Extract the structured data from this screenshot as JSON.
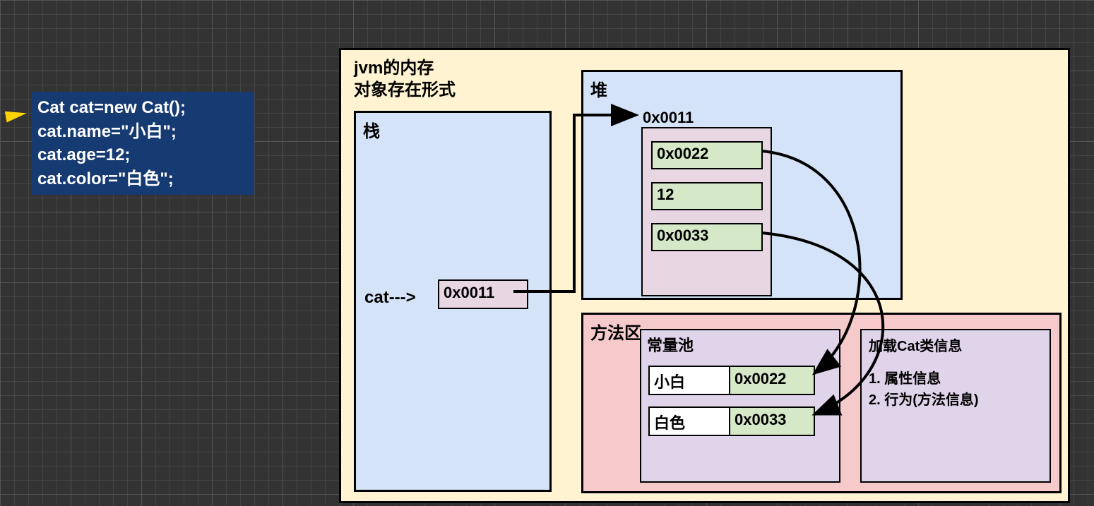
{
  "code": {
    "line1": "Cat cat=new Cat();",
    "line2": "cat.name=\"小白\";",
    "line3": "cat.age=12;",
    "line4": "cat.color=\"白色\";"
  },
  "jvm": {
    "title_line1": "jvm的内存",
    "title_line2": "对象存在形式"
  },
  "stack": {
    "label": "栈",
    "var": "cat--->",
    "addr": "0x0011"
  },
  "heap": {
    "label": "堆",
    "object_addr": "0x0011",
    "fields": {
      "name_ref": "0x0022",
      "age": "12",
      "color_ref": "0x0033"
    }
  },
  "method_area": {
    "label": "方法区",
    "const_pool": {
      "label": "常量池",
      "entry1": {
        "value": "小白",
        "addr": "0x0022"
      },
      "entry2": {
        "value": "白色",
        "addr": "0x0033"
      }
    },
    "class_info": {
      "title": "加载Cat类信息",
      "line1": "1. 属性信息",
      "line2": "2. 行为(方法信息)"
    }
  }
}
